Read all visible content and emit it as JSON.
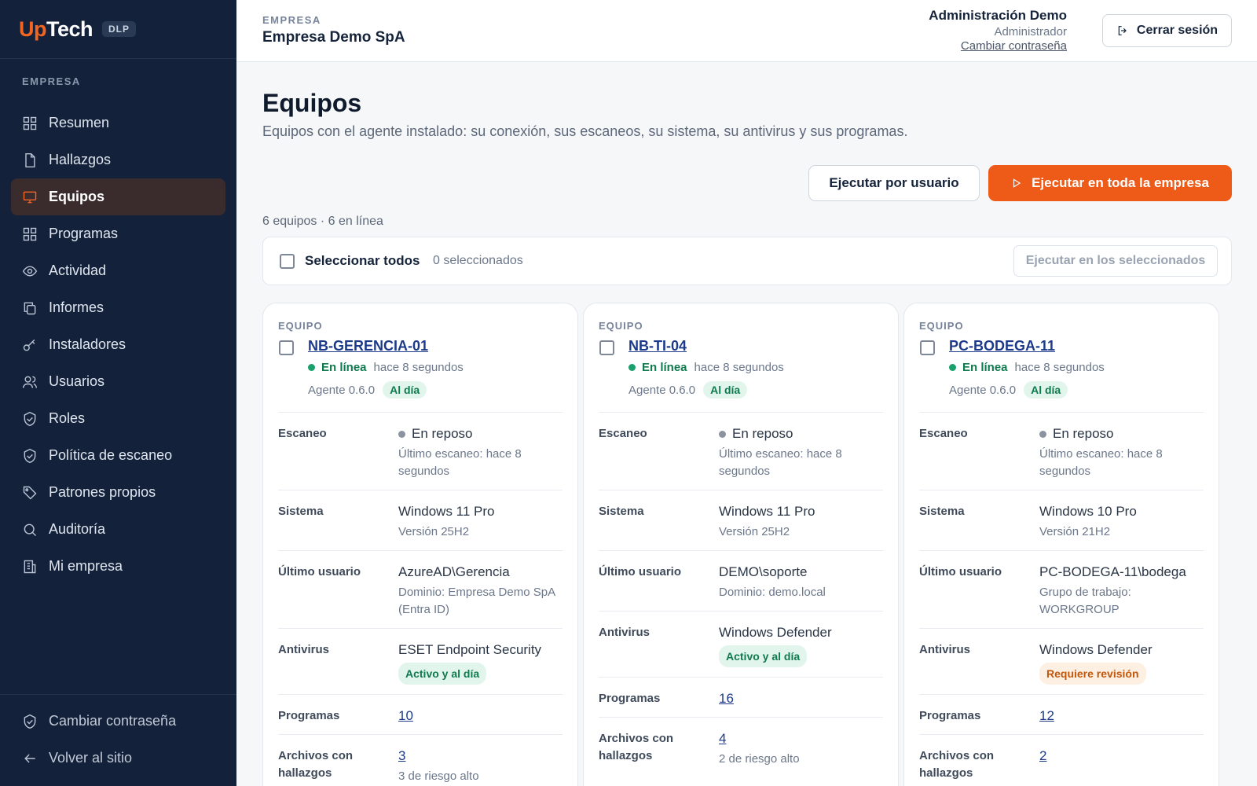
{
  "brand": {
    "up": "Up",
    "tech": "Tech",
    "badge": "DLP"
  },
  "sidebar": {
    "section": "EMPRESA",
    "items": [
      {
        "label": "Resumen",
        "icon": "grid-icon"
      },
      {
        "label": "Hallazgos",
        "icon": "file-icon"
      },
      {
        "label": "Equipos",
        "icon": "monitor-icon",
        "active": true
      },
      {
        "label": "Programas",
        "icon": "apps-icon"
      },
      {
        "label": "Actividad",
        "icon": "eye-icon"
      },
      {
        "label": "Informes",
        "icon": "copy-icon"
      },
      {
        "label": "Instaladores",
        "icon": "key-icon"
      },
      {
        "label": "Usuarios",
        "icon": "users-icon"
      },
      {
        "label": "Roles",
        "icon": "shield-check-icon"
      },
      {
        "label": "Política de escaneo",
        "icon": "shield-check-icon"
      },
      {
        "label": "Patrones propios",
        "icon": "tag-icon"
      },
      {
        "label": "Auditoría",
        "icon": "search-icon"
      },
      {
        "label": "Mi empresa",
        "icon": "building-icon"
      }
    ],
    "bottom": [
      {
        "label": "Cambiar contraseña",
        "icon": "shield-check-icon"
      },
      {
        "label": "Volver al sitio",
        "icon": "arrow-left-icon"
      }
    ]
  },
  "header": {
    "company_label": "EMPRESA",
    "company_name": "Empresa Demo SpA",
    "user_name": "Administración Demo",
    "user_role": "Administrador",
    "change_password": "Cambiar contraseña",
    "logout": "Cerrar sesión"
  },
  "main": {
    "title": "Equipos",
    "subtitle": "Equipos con el agente instalado: su conexión, sus escaneos, su sistema, su antivirus y sus programas.",
    "btn_by_user": "Ejecutar por usuario",
    "btn_all": "Ejecutar en toda la empresa",
    "count_line": "6 equipos · 6 en línea",
    "select_all": "Seleccionar todos",
    "selected_count": "0 seleccionados",
    "run_selected": "Ejecutar en los seleccionados"
  },
  "labels": {
    "equipo": "EQUIPO",
    "escaneo": "Escaneo",
    "sistema": "Sistema",
    "ultimo_usuario": "Último usuario",
    "antivirus": "Antivirus",
    "programas": "Programas",
    "archivos": "Archivos con hallazgos"
  },
  "devices": [
    {
      "name": "NB-GERENCIA-01",
      "status": "En línea",
      "seen": "hace 8 segundos",
      "agent": "Agente 0.6.0",
      "agent_badge": "Al día",
      "scan_state": "En reposo",
      "scan_last": "Último escaneo: hace 8 segundos",
      "os": "Windows 11 Pro",
      "os_version": "Versión 25H2",
      "user": "AzureAD\\Gerencia",
      "user_domain": "Dominio: Empresa Demo SpA (Entra ID)",
      "av": "ESET Endpoint Security",
      "av_badge": "Activo y al día",
      "av_badge_color": "#0f7a4d",
      "programs": "10",
      "files": "3",
      "files_risk": "3 de riesgo alto"
    },
    {
      "name": "NB-TI-04",
      "status": "En línea",
      "seen": "hace 8 segundos",
      "agent": "Agente 0.6.0",
      "agent_badge": "Al día",
      "scan_state": "En reposo",
      "scan_last": "Último escaneo: hace 8 segundos",
      "os": "Windows 11 Pro",
      "os_version": "Versión 25H2",
      "user": "DEMO\\soporte",
      "user_domain": "Dominio: demo.local",
      "av": "Windows Defender",
      "av_badge": "Activo y al día",
      "av_badge_color": "#0f7a4d",
      "programs": "16",
      "files": "4",
      "files_risk": "2 de riesgo alto"
    },
    {
      "name": "PC-BODEGA-11",
      "status": "En línea",
      "seen": "hace 8 segundos",
      "agent": "Agente 0.6.0",
      "agent_badge": "Al día",
      "scan_state": "En reposo",
      "scan_last": "Último escaneo: hace 8 segundos",
      "os": "Windows 10 Pro",
      "os_version": "Versión 21H2",
      "user": "PC-BODEGA-11\\bodega",
      "user_domain": "Grupo de trabajo: WORKGROUP",
      "av": "Windows Defender",
      "av_badge": "Requiere revisión",
      "av_badge_color": "#c2570c",
      "programs": "12",
      "files": "2",
      "files_risk": ""
    }
  ],
  "colors": {
    "accent": "#ee5a17",
    "sidebar_bg": "#13213a",
    "online": "#1aa06c"
  }
}
